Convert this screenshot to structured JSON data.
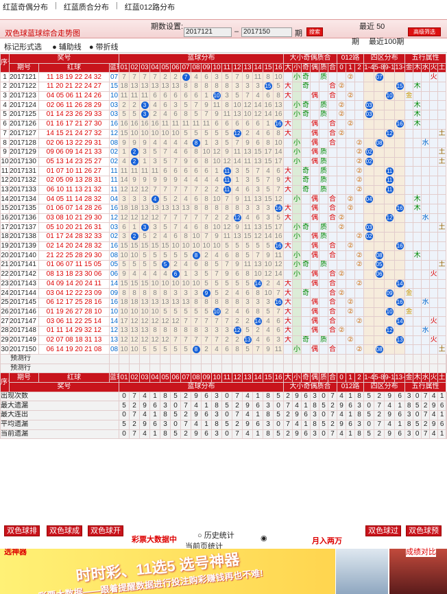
{
  "nav": [
    "红蓝奇偶分布",
    "红蓝质合分布",
    "红蓝012路分布"
  ],
  "title": "双色球蓝球综合走势图",
  "period_label": "期数设置:",
  "period_from": "2017121",
  "period_to": "2017150",
  "period_unit": "期",
  "search_btn": "搜索",
  "recent_prefix": "最近",
  "recent_value": "50",
  "recent_unit": "期",
  "recent100": "最近100期",
  "advanced_btn": "高级筛选",
  "mark_label": "标记形式选",
  "aux_line": "辅助线",
  "fold_line": "带折线",
  "headers": {
    "seq": "序号",
    "period": "期号",
    "prize": "奖号",
    "red": "红球",
    "blue": "蓝球",
    "blue_dist": "蓝球分布",
    "size": "大小奇偶质合",
    "route": "012路",
    "zone": "四区分布",
    "element": "五行属性",
    "nums": [
      "01",
      "02",
      "03",
      "04",
      "05",
      "06",
      "07",
      "08",
      "09",
      "10",
      "11",
      "12",
      "13",
      "14",
      "15",
      "16"
    ],
    "sub": [
      "大",
      "小",
      "奇",
      "偶",
      "质",
      "合",
      "0",
      "1",
      "2",
      "1-4",
      "5-8",
      "9-12",
      "13-16",
      "金",
      "木",
      "水",
      "火",
      "土"
    ]
  },
  "rows": [
    {
      "seq": "1",
      "period": "2017121",
      "red": "11 18 19 22 24 32",
      "blue": "07",
      "sz": "小",
      "oe": "奇",
      "pc": "质",
      "r": "1",
      "z": "2",
      "el": "火"
    },
    {
      "seq": "2",
      "period": "2017122",
      "red": "11 20 21 22 24 27",
      "blue": "15",
      "sz": "大",
      "oe": "奇",
      "pc": "合",
      "r": "0",
      "z": "4",
      "el": "木"
    },
    {
      "seq": "3",
      "period": "2017123",
      "red": "04 05 06 11 24 26",
      "blue": "10",
      "sz": "大",
      "oe": "偶",
      "pc": "合",
      "r": "1",
      "z": "3",
      "el": "金"
    },
    {
      "seq": "4",
      "period": "2017124",
      "red": "02 06 11 26 28 29",
      "blue": "03",
      "sz": "小",
      "oe": "奇",
      "pc": "质",
      "r": "0",
      "z": "1",
      "el": "木"
    },
    {
      "seq": "5",
      "period": "2017125",
      "red": "01 14 23 26 29 33",
      "blue": "03",
      "sz": "小",
      "oe": "奇",
      "pc": "质",
      "r": "0",
      "z": "1",
      "el": "木"
    },
    {
      "seq": "6",
      "period": "2017126",
      "red": "01 16 17 21 27 30",
      "blue": "16",
      "sz": "大",
      "oe": "偶",
      "pc": "合",
      "r": "1",
      "z": "4",
      "el": "木"
    },
    {
      "seq": "7",
      "period": "2017127",
      "red": "14 15 21 24 27 32",
      "blue": "12",
      "sz": "大",
      "oe": "偶",
      "pc": "合",
      "r": "0",
      "z": "3",
      "el": "土"
    },
    {
      "seq": "8",
      "period": "2017128",
      "red": "02 06 13 22 29 31",
      "blue": "08",
      "sz": "小",
      "oe": "偶",
      "pc": "合",
      "r": "2",
      "z": "2",
      "el": "水"
    },
    {
      "seq": "9",
      "period": "2017129",
      "red": "09 06 09 14 21 33",
      "blue": "02",
      "sz": "小",
      "oe": "偶",
      "pc": "质",
      "r": "2",
      "z": "1",
      "el": "土"
    },
    {
      "seq": "10",
      "period": "2017130",
      "red": "05 13 14 23 25 27",
      "blue": "02",
      "sz": "小",
      "oe": "偶",
      "pc": "质",
      "r": "2",
      "z": "1",
      "el": "土"
    },
    {
      "seq": "11",
      "period": "2017131",
      "red": "01 07 10 11 26 27",
      "blue": "11",
      "sz": "大",
      "oe": "奇",
      "pc": "质",
      "r": "2",
      "z": "3",
      "el": ""
    },
    {
      "seq": "12",
      "period": "2017132",
      "red": "02 05 09 13 28 31",
      "blue": "11",
      "sz": "大",
      "oe": "奇",
      "pc": "质",
      "r": "2",
      "z": "3",
      "el": ""
    },
    {
      "seq": "13",
      "period": "2017133",
      "red": "06 10 11 13 21 32",
      "blue": "11",
      "sz": "大",
      "oe": "奇",
      "pc": "质",
      "r": "2",
      "z": "3",
      "el": ""
    },
    {
      "seq": "14",
      "period": "2017134",
      "red": "04 05 11 14 28 32",
      "blue": "04",
      "sz": "小",
      "oe": "偶",
      "pc": "合",
      "r": "1",
      "z": "1",
      "el": "木"
    },
    {
      "seq": "15",
      "period": "2017135",
      "red": "01 06 07 14 28 26",
      "blue": "16",
      "sz": "大",
      "oe": "偶",
      "pc": "合",
      "r": "1",
      "z": "4",
      "el": "木"
    },
    {
      "seq": "16",
      "period": "2017136",
      "red": "03 08 10 21 29 30",
      "blue": "12",
      "sz": "大",
      "oe": "偶",
      "pc": "合",
      "r": "0",
      "z": "3",
      "el": "水"
    },
    {
      "seq": "17",
      "period": "2017137",
      "red": "05 10 20 21 26 31",
      "blue": "03",
      "sz": "小",
      "oe": "奇",
      "pc": "质",
      "r": "0",
      "z": "1",
      "el": "土"
    },
    {
      "seq": "18",
      "period": "2017138",
      "red": "01 17 24 28 32 33",
      "blue": "02",
      "sz": "小",
      "oe": "偶",
      "pc": "质",
      "r": "2",
      "z": "1",
      "el": ""
    },
    {
      "seq": "19",
      "period": "2017139",
      "red": "02 14 20 24 28 32",
      "blue": "16",
      "sz": "大",
      "oe": "偶",
      "pc": "合",
      "r": "1",
      "z": "4",
      "el": ""
    },
    {
      "seq": "20",
      "period": "2017140",
      "red": "21 22 25 28 29 30",
      "blue": "08",
      "sz": "小",
      "oe": "偶",
      "pc": "合",
      "r": "2",
      "z": "2",
      "el": "木"
    },
    {
      "seq": "21",
      "period": "2017141",
      "red": "01 06 07 11 15 05",
      "blue": "05",
      "sz": "小",
      "oe": "奇",
      "pc": "质",
      "r": "2",
      "z": "2",
      "el": "土"
    },
    {
      "seq": "22",
      "period": "2017142",
      "red": "08 13 18 23 30 06",
      "blue": "06",
      "sz": "小",
      "oe": "偶",
      "pc": "合",
      "r": "0",
      "z": "2",
      "el": "火"
    },
    {
      "seq": "23",
      "period": "2017143",
      "red": "04 09 14 20 24 11",
      "blue": "14",
      "sz": "大",
      "oe": "偶",
      "pc": "合",
      "r": "2",
      "z": "4",
      "el": ""
    },
    {
      "seq": "24",
      "period": "2017144",
      "red": "03 04 12 22 23 09",
      "blue": "09",
      "sz": "大",
      "oe": "奇",
      "pc": "合",
      "r": "0",
      "z": "3",
      "el": "金"
    },
    {
      "seq": "25",
      "period": "2017145",
      "red": "06 12 17 25 28 16",
      "blue": "16",
      "sz": "大",
      "oe": "偶",
      "pc": "合",
      "r": "1",
      "z": "4",
      "el": "水"
    },
    {
      "seq": "26",
      "period": "2017146",
      "red": "01 19 26 27 28 10",
      "blue": "10",
      "sz": "大",
      "oe": "偶",
      "pc": "合",
      "r": "1",
      "z": "3",
      "el": "金"
    },
    {
      "seq": "27",
      "period": "2017147",
      "red": "03 06 11 22 25 14",
      "blue": "14",
      "sz": "大",
      "oe": "偶",
      "pc": "合",
      "r": "2",
      "z": "4",
      "el": "火"
    },
    {
      "seq": "28",
      "period": "2017148",
      "red": "01 11 14 29 32 12",
      "blue": "12",
      "sz": "大",
      "oe": "偶",
      "pc": "合",
      "r": "0",
      "z": "3",
      "el": "水"
    },
    {
      "seq": "29",
      "period": "2017149",
      "red": "02 07 08 18 31 13",
      "blue": "13",
      "sz": "大",
      "oe": "奇",
      "pc": "质",
      "r": "1",
      "z": "4",
      "el": "火"
    },
    {
      "seq": "30",
      "period": "2017150",
      "red": "06 14 19 20 21 08",
      "blue": "08",
      "sz": "小",
      "oe": "偶",
      "pc": "合",
      "r": "2",
      "z": "2",
      "el": "土"
    }
  ],
  "pred_label1": "预测行",
  "pred_label2": "预测行",
  "stat_labels": [
    "出现次数",
    "最大遗漏",
    "最大连出",
    "平均遗漏",
    "当前遗漏"
  ],
  "bottom": {
    "link1": "双色球排",
    "link2": "双色球成",
    "link3": "双色球开",
    "big_data": "彩票大数据中",
    "history": "历史统计",
    "current": "当前页统计",
    "month": "月入两万",
    "link4": "双色球过",
    "link5": "双色球预"
  },
  "banner": {
    "left_label": "选神器",
    "title": "时时彩、11选5 选号神器",
    "sub": "彩票大数据——跟着提醒数据进行投注购彩赚钱再也不难!",
    "right_label": "成绩对比"
  }
}
